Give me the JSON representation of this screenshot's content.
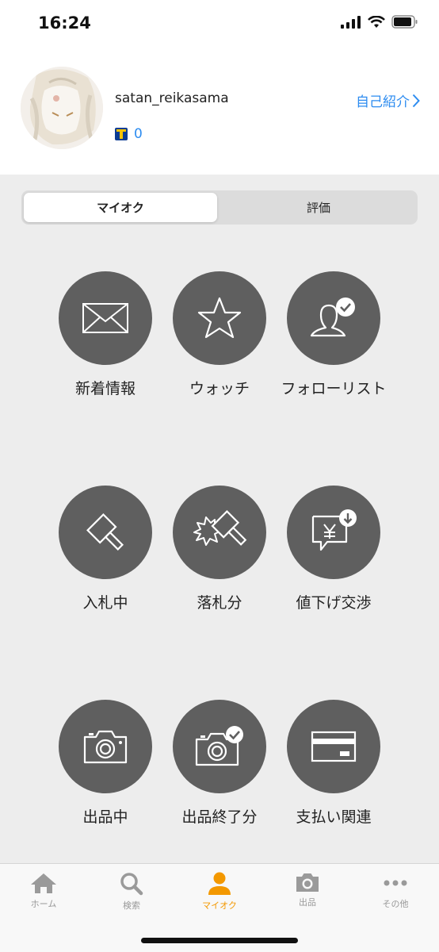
{
  "status_bar": {
    "time": "16:24"
  },
  "profile": {
    "username": "satan_reikasama",
    "tpoint_value": "0",
    "intro_link": "自己紹介"
  },
  "segment": {
    "tabs": [
      "マイオク",
      "評価"
    ],
    "active": "マイオク"
  },
  "menu": [
    {
      "label": "新着情報",
      "icon": "envelope-icon"
    },
    {
      "label": "ウォッチ",
      "icon": "star-icon"
    },
    {
      "label": "フォローリスト",
      "icon": "follow-user-icon"
    },
    {
      "label": "入札中",
      "icon": "gavel-icon"
    },
    {
      "label": "落札分",
      "icon": "gavel-won-icon"
    },
    {
      "label": "値下げ交渉",
      "icon": "price-down-icon"
    },
    {
      "label": "出品中",
      "icon": "camera-icon"
    },
    {
      "label": "出品終了分",
      "icon": "camera-check-icon"
    },
    {
      "label": "支払い関連",
      "icon": "credit-card-icon"
    }
  ],
  "tabbar": [
    {
      "label": "ホーム",
      "icon": "home-icon"
    },
    {
      "label": "検索",
      "icon": "search-icon"
    },
    {
      "label": "マイオク",
      "icon": "person-icon",
      "active": true
    },
    {
      "label": "出品",
      "icon": "camera-icon"
    },
    {
      "label": "その他",
      "icon": "more-icon"
    }
  ],
  "colors": {
    "accent": "#f39800",
    "link": "#2d8cf0",
    "icon_bg": "#5f5f5f",
    "background": "#ededed"
  }
}
